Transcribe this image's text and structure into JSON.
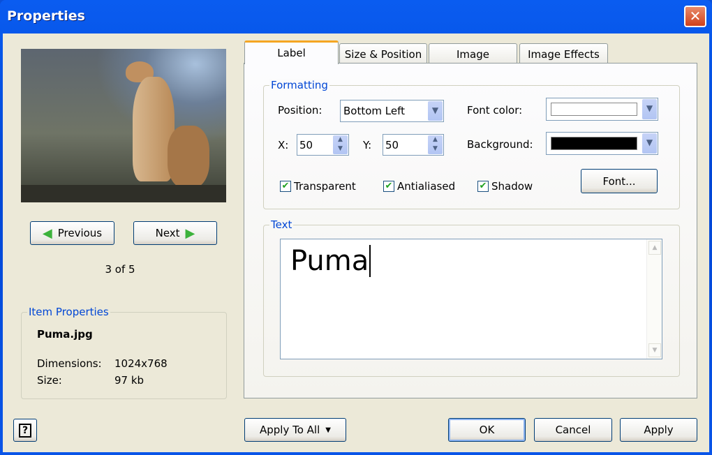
{
  "window": {
    "title": "Properties",
    "close_icon": "close-icon"
  },
  "preview": {
    "prev_label": "Previous",
    "next_label": "Next",
    "counter": "3 of 5"
  },
  "item_properties": {
    "legend": "Item Properties",
    "filename": "Puma.jpg",
    "dimensions_label": "Dimensions:",
    "dimensions_value": "1024x768",
    "size_label": "Size:",
    "size_value": "97 kb"
  },
  "tabs": [
    {
      "label": "Label",
      "active": true
    },
    {
      "label": "Size & Position"
    },
    {
      "label": "Image"
    },
    {
      "label": "Image Effects"
    }
  ],
  "formatting": {
    "legend": "Formatting",
    "position_label": "Position:",
    "position_value": "Bottom Left",
    "x_label": "X:",
    "x_value": "50",
    "y_label": "Y:",
    "y_value": "50",
    "font_color_label": "Font color:",
    "font_color": "#ffffff",
    "background_label": "Background:",
    "background_color": "#000000",
    "transparent_label": "Transparent",
    "antialiased_label": "Antialiased",
    "shadow_label": "Shadow",
    "transparent": true,
    "antialiased": true,
    "shadow": true,
    "font_button": "Font..."
  },
  "text": {
    "legend": "Text",
    "value": "Puma"
  },
  "footer": {
    "apply_to_all": "Apply To All",
    "ok": "OK",
    "cancel": "Cancel",
    "apply": "Apply",
    "help_icon": "help-icon"
  }
}
